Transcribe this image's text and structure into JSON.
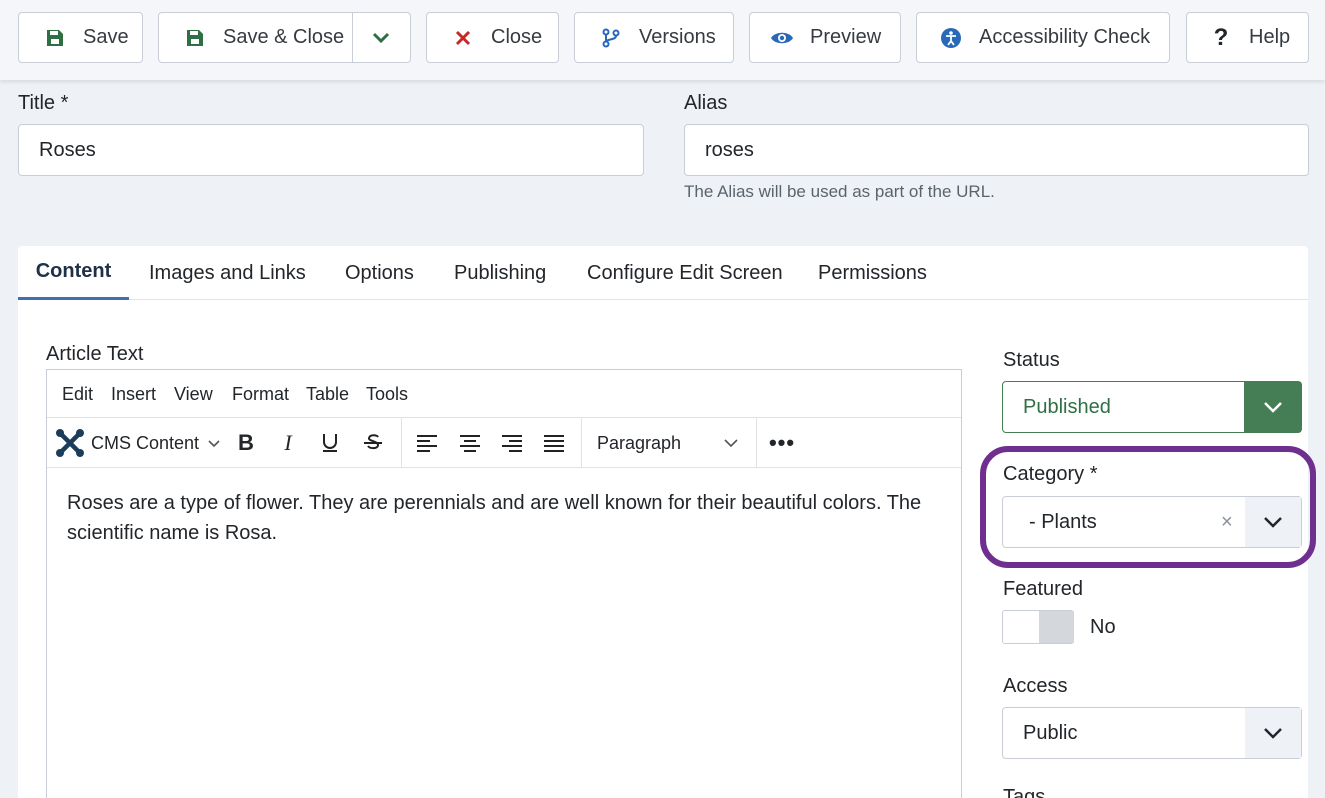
{
  "toolbar": {
    "save": "Save",
    "save_close": "Save & Close",
    "close": "Close",
    "versions": "Versions",
    "preview": "Preview",
    "accessibility": "Accessibility Check",
    "help": "Help"
  },
  "fields": {
    "title_label": "Title *",
    "title_value": "Roses",
    "alias_label": "Alias",
    "alias_value": "roses",
    "alias_hint": "The Alias will be used as part of the URL."
  },
  "tabs": [
    "Content",
    "Images and Links",
    "Options",
    "Publishing",
    "Configure Edit Screen",
    "Permissions"
  ],
  "editor": {
    "label": "Article Text",
    "menu": [
      "Edit",
      "Insert",
      "View",
      "Format",
      "Table",
      "Tools"
    ],
    "cms_content": "CMS Content",
    "paragraph": "Paragraph",
    "text": "Roses are a type of flower. They are perennials and are well known for their beautiful colors. The scientific name is Rosa."
  },
  "sidebar": {
    "status_label": "Status",
    "status_value": "Published",
    "category_label": "Category *",
    "category_value": "- Plants",
    "featured_label": "Featured",
    "featured_value": "No",
    "access_label": "Access",
    "access_value": "Public",
    "tags_label": "Tags"
  },
  "colors": {
    "published": "#457d54",
    "highlight": "#6e2f8e",
    "active_tab": "#3f6fb5",
    "close_red": "#c52827",
    "save_green": "#2f6f44",
    "blue_icon": "#2a69b8"
  },
  "icons": [
    "save-icon",
    "chevron-down-icon",
    "close-icon",
    "branch-icon",
    "eye-icon",
    "accessibility-icon",
    "question-icon",
    "joomla-icon",
    "bold-icon",
    "italic-icon",
    "underline-icon",
    "strikethrough-icon",
    "align-left-icon",
    "align-center-icon",
    "align-right-icon",
    "justify-icon",
    "more-icon",
    "clear-icon"
  ]
}
